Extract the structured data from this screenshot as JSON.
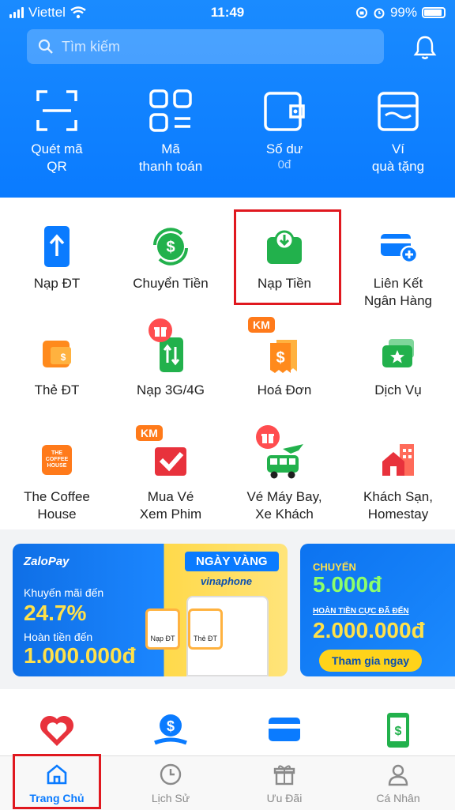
{
  "status": {
    "carrier": "Viettel",
    "time": "11:49",
    "battery": "99%"
  },
  "search": {
    "placeholder": "Tìm kiếm"
  },
  "quick_actions": [
    {
      "line1": "Quét mã",
      "line2": "QR",
      "icon": "qr-scan-icon"
    },
    {
      "line1": "Mã",
      "line2": "thanh toán",
      "icon": "payment-code-icon"
    },
    {
      "line1": "Số dư",
      "line2": "0đ",
      "icon": "wallet-icon"
    },
    {
      "line1": "Ví",
      "line2": "quà tặng",
      "icon": "gift-wallet-icon"
    }
  ],
  "services": [
    {
      "line1": "Nạp ĐT",
      "line2": "",
      "icon": "phone-topup-icon"
    },
    {
      "line1": "Chuyển Tiền",
      "line2": "",
      "icon": "transfer-money-icon"
    },
    {
      "line1": "Nạp Tiền",
      "line2": "",
      "icon": "deposit-icon"
    },
    {
      "line1": "Liên Kết",
      "line2": "Ngân Hàng",
      "icon": "bank-link-icon"
    },
    {
      "line1": "Thẻ ĐT",
      "line2": "",
      "icon": "phone-card-icon"
    },
    {
      "line1": "Nạp 3G/4G",
      "line2": "",
      "icon": "data-topup-icon"
    },
    {
      "line1": "Hoá Đơn",
      "line2": "",
      "icon": "bill-icon"
    },
    {
      "line1": "Dịch Vụ",
      "line2": "",
      "icon": "services-icon"
    },
    {
      "line1": "The Coffee",
      "line2": "House",
      "icon": "coffee-house-icon"
    },
    {
      "line1": "Mua Vé",
      "line2": "Xem Phim",
      "icon": "movie-ticket-icon"
    },
    {
      "line1": "Vé Máy Bay,",
      "line2": "Xe Khách",
      "icon": "flight-bus-icon"
    },
    {
      "line1": "Khách Sạn,",
      "line2": "Homestay",
      "icon": "hotel-icon"
    }
  ],
  "badges": {
    "km": "KM",
    "coffee_logo": "THE COFFEE HOUSE"
  },
  "banner1": {
    "brand": "ZaloPay",
    "promo_label": "Khuyến mãi đến",
    "promo_value": "24.7%",
    "refund_label": "Hoàn tiền đến",
    "refund_value": "1.000.000đ",
    "tag": "NGÀY VÀNG",
    "partner": "vinaphone",
    "tile1": "Nạp ĐT",
    "tile2": "Thẻ ĐT"
  },
  "banner2": {
    "label": "CHUYỂN",
    "amount": "5.000đ",
    "refund_label": "HOÀN TIỀN CỰC ĐÃ ĐẾN",
    "refund_value": "2.000.000đ",
    "cta": "Tham gia ngay"
  },
  "nav": [
    {
      "label": "Trang Chủ",
      "icon": "home-icon",
      "active": true
    },
    {
      "label": "Lịch Sử",
      "icon": "clock-icon",
      "active": false
    },
    {
      "label": "Ưu Đãi",
      "icon": "gift-icon",
      "active": false
    },
    {
      "label": "Cá Nhân",
      "icon": "user-icon",
      "active": false
    }
  ],
  "colors": {
    "primary": "#0a7bff",
    "green": "#22b14c",
    "orange": "#ff8a1c",
    "highlight": "#e0181f"
  }
}
